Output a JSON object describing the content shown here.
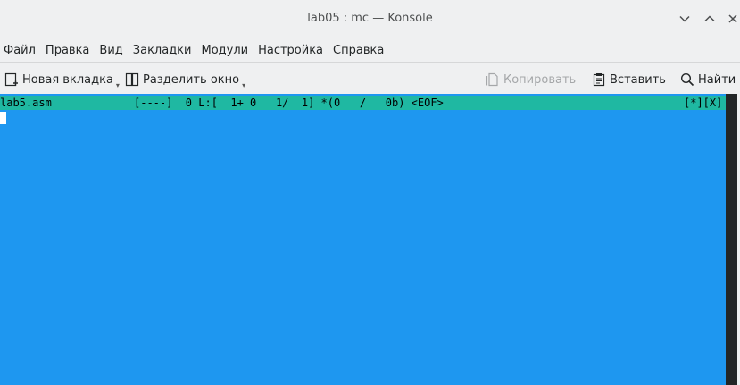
{
  "window": {
    "title": "lab05 : mc — Konsole",
    "minimize_icon": "chevron-down-icon",
    "maximize_icon": "chevron-up-icon",
    "close_icon": "close-icon"
  },
  "menubar": {
    "items": [
      "Файл",
      "Правка",
      "Вид",
      "Закладки",
      "Модули",
      "Настройка",
      "Справка"
    ]
  },
  "toolbar": {
    "new_tab": "Новая вкладка",
    "split_view": "Разделить окно",
    "copy": "Копировать",
    "paste": "Вставить",
    "find": "Найти"
  },
  "terminal": {
    "filename": "lab5.asm",
    "status": "[----]  0 L:[  1+ 0   1/  1] *(0   /   0b) <EOF>",
    "flags": "[*][X]",
    "colors": {
      "background": "#1e97f0",
      "status_bar": "#1fb8a2"
    }
  }
}
